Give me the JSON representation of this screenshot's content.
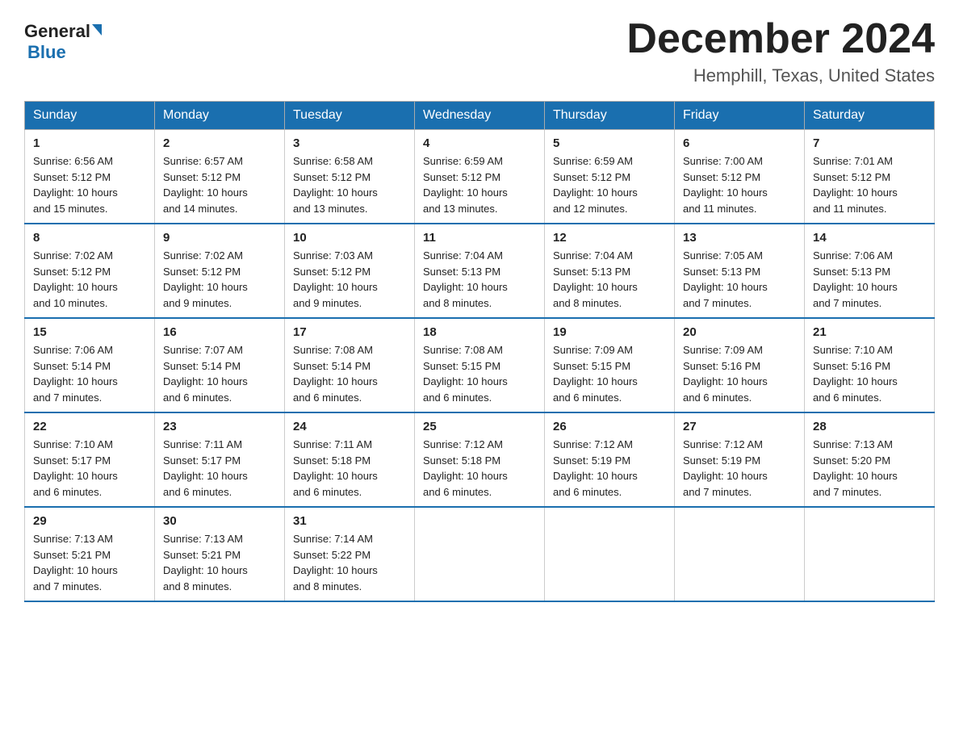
{
  "header": {
    "logo_general": "General",
    "logo_blue": "Blue",
    "month_title": "December 2024",
    "location": "Hemphill, Texas, United States"
  },
  "days_of_week": [
    "Sunday",
    "Monday",
    "Tuesday",
    "Wednesday",
    "Thursday",
    "Friday",
    "Saturday"
  ],
  "weeks": [
    [
      {
        "num": "1",
        "sunrise": "6:56 AM",
        "sunset": "5:12 PM",
        "daylight": "10 hours and 15 minutes."
      },
      {
        "num": "2",
        "sunrise": "6:57 AM",
        "sunset": "5:12 PM",
        "daylight": "10 hours and 14 minutes."
      },
      {
        "num": "3",
        "sunrise": "6:58 AM",
        "sunset": "5:12 PM",
        "daylight": "10 hours and 13 minutes."
      },
      {
        "num": "4",
        "sunrise": "6:59 AM",
        "sunset": "5:12 PM",
        "daylight": "10 hours and 13 minutes."
      },
      {
        "num": "5",
        "sunrise": "6:59 AM",
        "sunset": "5:12 PM",
        "daylight": "10 hours and 12 minutes."
      },
      {
        "num": "6",
        "sunrise": "7:00 AM",
        "sunset": "5:12 PM",
        "daylight": "10 hours and 11 minutes."
      },
      {
        "num": "7",
        "sunrise": "7:01 AM",
        "sunset": "5:12 PM",
        "daylight": "10 hours and 11 minutes."
      }
    ],
    [
      {
        "num": "8",
        "sunrise": "7:02 AM",
        "sunset": "5:12 PM",
        "daylight": "10 hours and 10 minutes."
      },
      {
        "num": "9",
        "sunrise": "7:02 AM",
        "sunset": "5:12 PM",
        "daylight": "10 hours and 9 minutes."
      },
      {
        "num": "10",
        "sunrise": "7:03 AM",
        "sunset": "5:12 PM",
        "daylight": "10 hours and 9 minutes."
      },
      {
        "num": "11",
        "sunrise": "7:04 AM",
        "sunset": "5:13 PM",
        "daylight": "10 hours and 8 minutes."
      },
      {
        "num": "12",
        "sunrise": "7:04 AM",
        "sunset": "5:13 PM",
        "daylight": "10 hours and 8 minutes."
      },
      {
        "num": "13",
        "sunrise": "7:05 AM",
        "sunset": "5:13 PM",
        "daylight": "10 hours and 7 minutes."
      },
      {
        "num": "14",
        "sunrise": "7:06 AM",
        "sunset": "5:13 PM",
        "daylight": "10 hours and 7 minutes."
      }
    ],
    [
      {
        "num": "15",
        "sunrise": "7:06 AM",
        "sunset": "5:14 PM",
        "daylight": "10 hours and 7 minutes."
      },
      {
        "num": "16",
        "sunrise": "7:07 AM",
        "sunset": "5:14 PM",
        "daylight": "10 hours and 6 minutes."
      },
      {
        "num": "17",
        "sunrise": "7:08 AM",
        "sunset": "5:14 PM",
        "daylight": "10 hours and 6 minutes."
      },
      {
        "num": "18",
        "sunrise": "7:08 AM",
        "sunset": "5:15 PM",
        "daylight": "10 hours and 6 minutes."
      },
      {
        "num": "19",
        "sunrise": "7:09 AM",
        "sunset": "5:15 PM",
        "daylight": "10 hours and 6 minutes."
      },
      {
        "num": "20",
        "sunrise": "7:09 AM",
        "sunset": "5:16 PM",
        "daylight": "10 hours and 6 minutes."
      },
      {
        "num": "21",
        "sunrise": "7:10 AM",
        "sunset": "5:16 PM",
        "daylight": "10 hours and 6 minutes."
      }
    ],
    [
      {
        "num": "22",
        "sunrise": "7:10 AM",
        "sunset": "5:17 PM",
        "daylight": "10 hours and 6 minutes."
      },
      {
        "num": "23",
        "sunrise": "7:11 AM",
        "sunset": "5:17 PM",
        "daylight": "10 hours and 6 minutes."
      },
      {
        "num": "24",
        "sunrise": "7:11 AM",
        "sunset": "5:18 PM",
        "daylight": "10 hours and 6 minutes."
      },
      {
        "num": "25",
        "sunrise": "7:12 AM",
        "sunset": "5:18 PM",
        "daylight": "10 hours and 6 minutes."
      },
      {
        "num": "26",
        "sunrise": "7:12 AM",
        "sunset": "5:19 PM",
        "daylight": "10 hours and 6 minutes."
      },
      {
        "num": "27",
        "sunrise": "7:12 AM",
        "sunset": "5:19 PM",
        "daylight": "10 hours and 7 minutes."
      },
      {
        "num": "28",
        "sunrise": "7:13 AM",
        "sunset": "5:20 PM",
        "daylight": "10 hours and 7 minutes."
      }
    ],
    [
      {
        "num": "29",
        "sunrise": "7:13 AM",
        "sunset": "5:21 PM",
        "daylight": "10 hours and 7 minutes."
      },
      {
        "num": "30",
        "sunrise": "7:13 AM",
        "sunset": "5:21 PM",
        "daylight": "10 hours and 8 minutes."
      },
      {
        "num": "31",
        "sunrise": "7:14 AM",
        "sunset": "5:22 PM",
        "daylight": "10 hours and 8 minutes."
      },
      null,
      null,
      null,
      null
    ]
  ],
  "labels": {
    "sunrise": "Sunrise:",
    "sunset": "Sunset:",
    "daylight": "Daylight:"
  }
}
